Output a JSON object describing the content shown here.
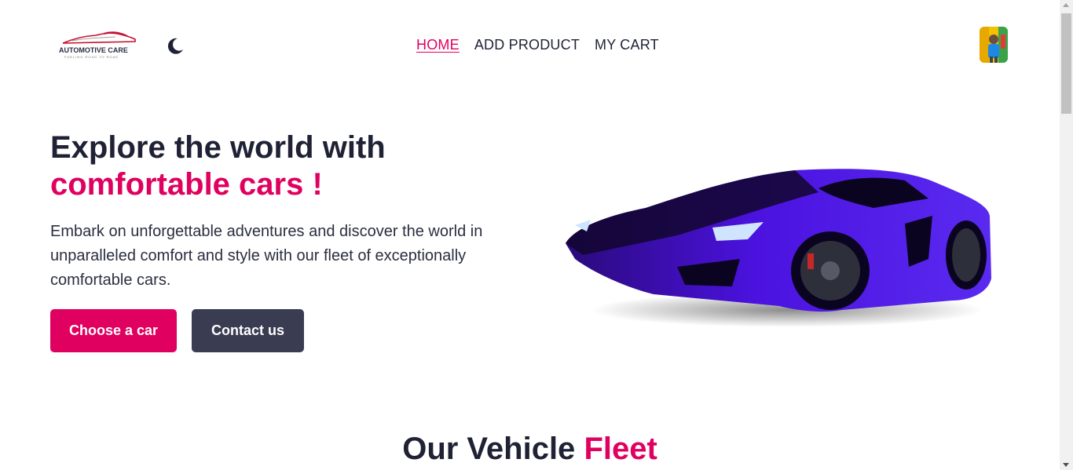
{
  "header": {
    "logo": {
      "brand": "AUTOMOTIVE CARE",
      "tagline": "FUELING ROAD TO ROAD"
    },
    "theme_toggle_icon": "moon-icon",
    "nav": [
      {
        "label": "HOME",
        "active": true
      },
      {
        "label": "ADD PRODUCT",
        "active": false
      },
      {
        "label": "MY CART",
        "active": false
      }
    ],
    "avatar_icon": "user-avatar"
  },
  "hero": {
    "title_line1": "Explore the world with",
    "title_line2": "comfortable cars !",
    "description": "Embark on unforgettable adventures and discover the world in unparalleled comfort and style with our fleet of exceptionally comfortable cars.",
    "primary_button": "Choose a car",
    "secondary_button": "Contact us",
    "image": "purple-sports-car"
  },
  "fleet_section": {
    "title_main": "Our Vehicle",
    "title_accent": "Fleet"
  },
  "colors": {
    "accent": "#e0005f",
    "dark": "#1f2235",
    "secondary_button": "#3a3c52",
    "car": "#4b12e0"
  }
}
